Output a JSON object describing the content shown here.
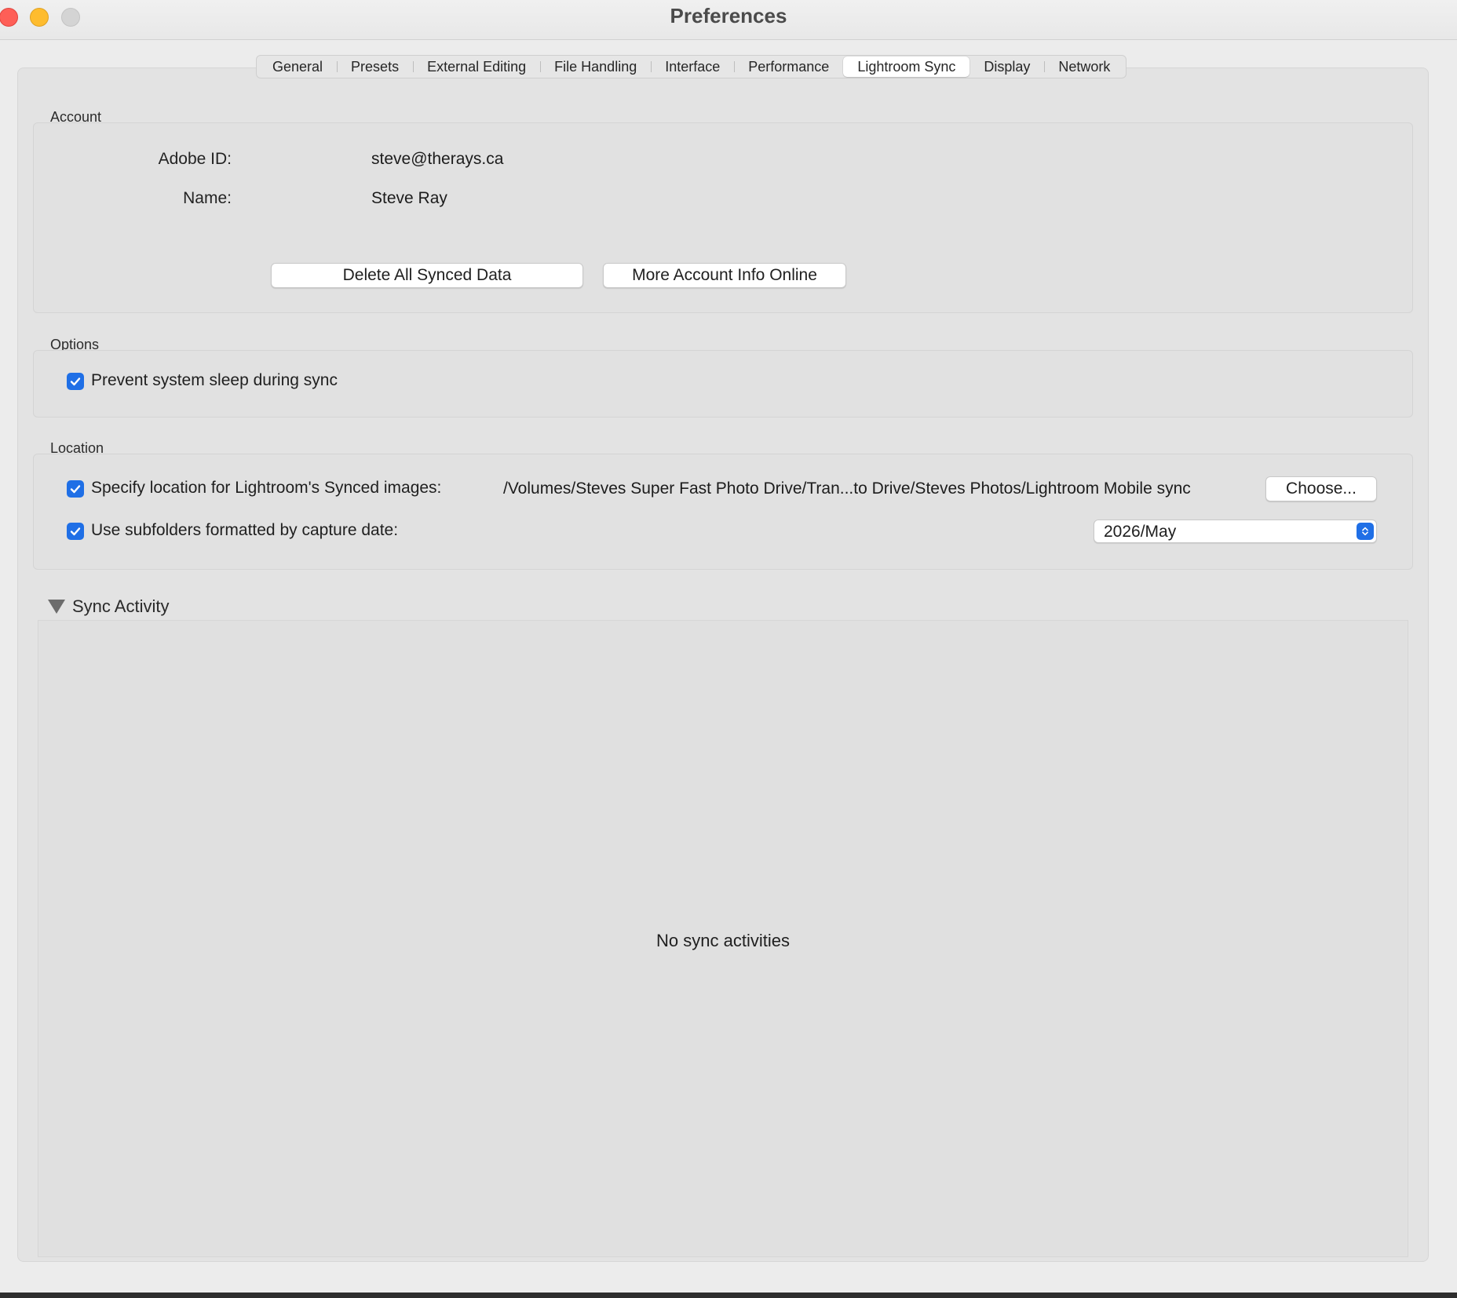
{
  "window": {
    "title": "Preferences"
  },
  "tabs": [
    {
      "label": "General",
      "active": false
    },
    {
      "label": "Presets",
      "active": false
    },
    {
      "label": "External Editing",
      "active": false
    },
    {
      "label": "File Handling",
      "active": false
    },
    {
      "label": "Interface",
      "active": false
    },
    {
      "label": "Performance",
      "active": false
    },
    {
      "label": "Lightroom Sync",
      "active": true
    },
    {
      "label": "Display",
      "active": false
    },
    {
      "label": "Network",
      "active": false
    }
  ],
  "account": {
    "section_label": "Account",
    "adobe_id_label": "Adobe ID:",
    "adobe_id_value": "steve@therays.ca",
    "name_label": "Name:",
    "name_value": "Steve Ray",
    "delete_button": "Delete All Synced Data",
    "more_info_button": "More Account Info Online"
  },
  "options": {
    "section_label": "Options",
    "prevent_sleep_label": "Prevent system sleep during sync",
    "prevent_sleep_checked": true
  },
  "location": {
    "section_label": "Location",
    "specify_label": "Specify location for Lightroom's Synced images:",
    "specify_checked": true,
    "path_value": "/Volumes/Steves Super Fast Photo Drive/Tran...to Drive/Steves Photos/Lightroom Mobile sync",
    "choose_button": "Choose...",
    "subfolders_label": "Use subfolders formatted by capture date:",
    "subfolders_checked": true,
    "date_format_value": "2026/May"
  },
  "sync_activity": {
    "title": "Sync Activity",
    "empty_message": "No sync activities"
  },
  "colors": {
    "accent": "#1f6fe6",
    "close": "#fe5f57",
    "minimize": "#febc2e",
    "zoom_disabled": "#d4d4d4"
  }
}
